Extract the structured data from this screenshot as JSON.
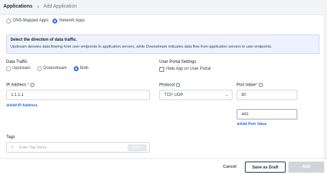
{
  "breadcrumb": {
    "root": "Applications",
    "separator": "›",
    "current": "Add Application"
  },
  "app_type": {
    "options": [
      "DNS-Mapped Apps",
      "Network Apps"
    ],
    "selected": "Network Apps"
  },
  "info": {
    "title": "Select the direction of data traffic.",
    "text": "Upstream denotes data flowing from user endpoints to application servers, while Downstream indicates data flow from application servers to user endpoints."
  },
  "data_traffic": {
    "label": "Data Traffic",
    "options": [
      "Upstream",
      "Downstream",
      "Both"
    ],
    "selected": "Both"
  },
  "user_portal": {
    "label": "User Portal Settings",
    "checkbox_label": "Hide App on User Portal",
    "checked": false
  },
  "ip_address": {
    "label": "IP Address",
    "value": "1.1.1.1",
    "add_link": "Add IP Address"
  },
  "protocol": {
    "label": "Protocol",
    "value": "TCP, UDP"
  },
  "port": {
    "label": "Port Value",
    "values": [
      "80",
      "443"
    ],
    "add_link": "Add Port Value"
  },
  "tags": {
    "label": "Tags",
    "placeholder": "Enter Tag Name",
    "add_label": "Add +"
  },
  "footer": {
    "cancel": "Cancel",
    "draft": "Save as Draft",
    "add": "Add"
  }
}
